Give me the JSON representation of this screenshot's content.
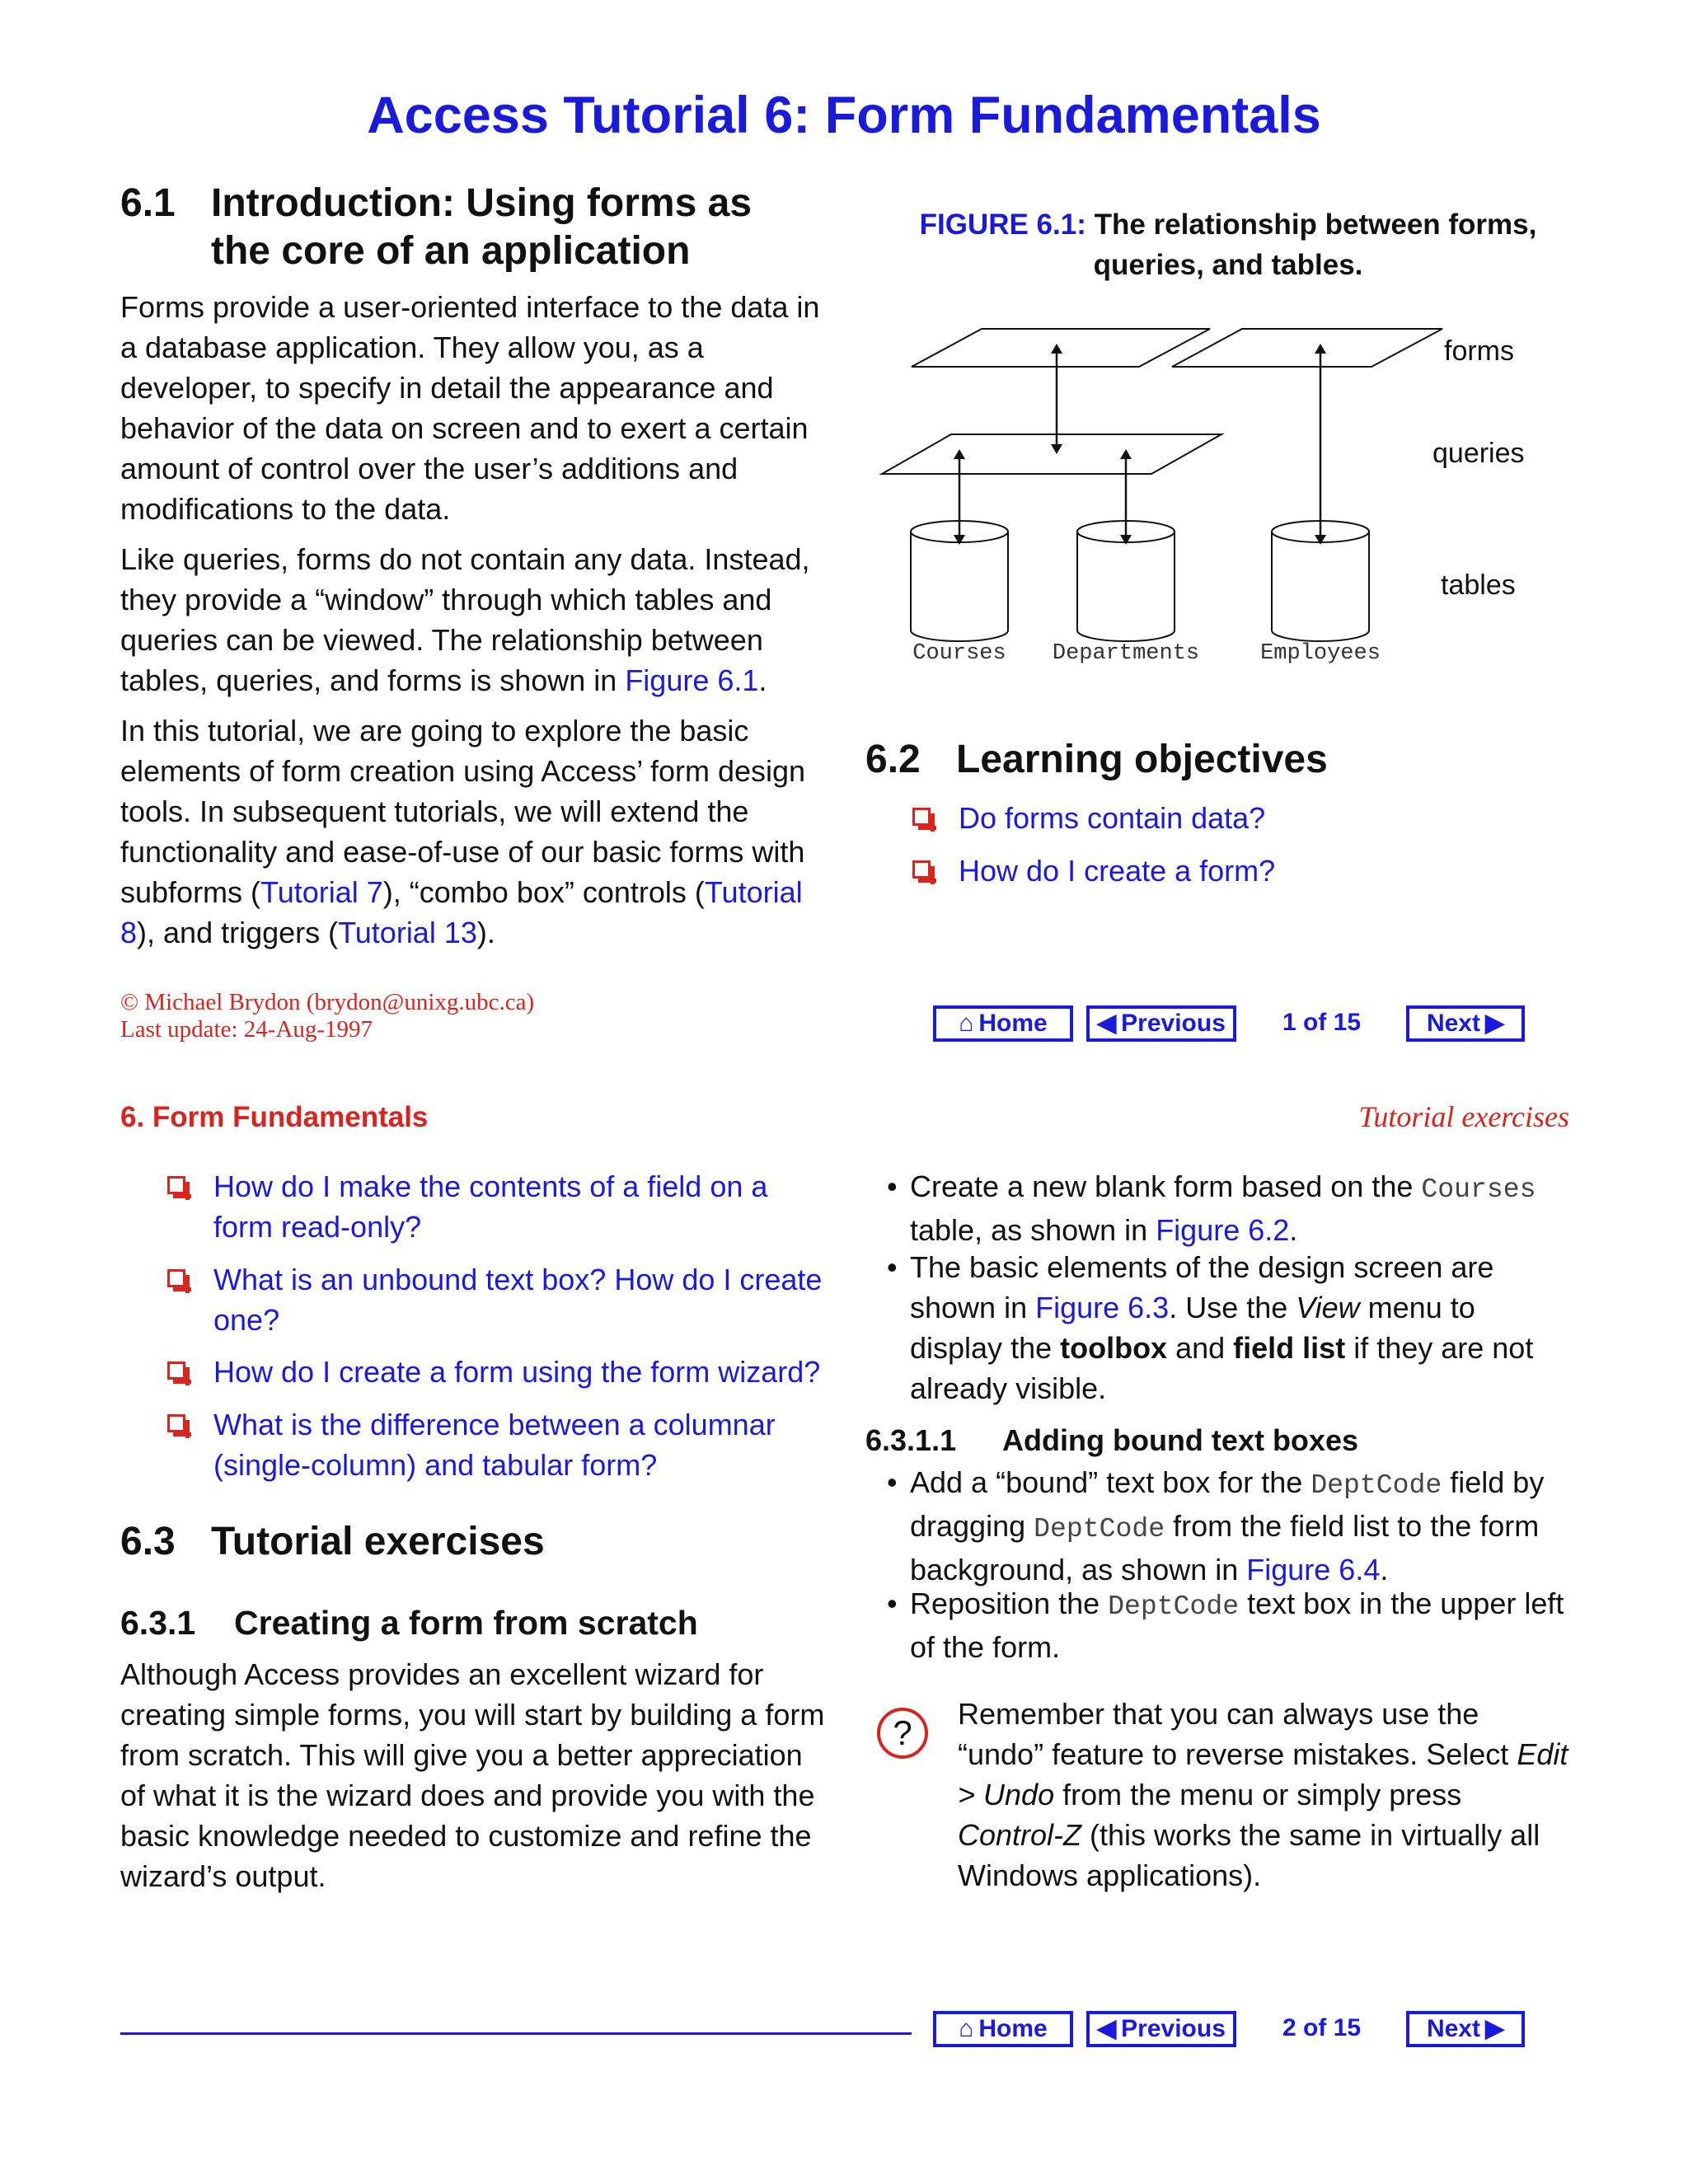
{
  "title": "Access Tutorial 6:  Form Fundamentals",
  "page1": {
    "s61": {
      "num": "6.1",
      "heading_line1": "Introduction: Using forms as",
      "heading_line2": "the core of an application",
      "p1": "Forms provide a user-oriented interface to the data in a database application. They allow you, as a developer, to specify in detail the appearance and behavior of the data on screen and to exert a certain amount of control over the user’s additions and modifications to the data.",
      "p2_a": "Like queries, forms do not contain any data. Instead, they provide a “window” through which tables and queries can be viewed. The relationship between tables, queries, and forms is shown in ",
      "p2_link": "Figure 6.1",
      "p2_b": ".",
      "p3_a": "In this tutorial, we are going to explore the basic elements of form creation using Access’ form design tools. In subsequent tutorials, we will extend the functionality and ease-of-use of our basic forms with subforms (",
      "p3_link1": "Tutorial 7",
      "p3_b": "), “combo box” controls (",
      "p3_link2": "Tutorial 8",
      "p3_c": "), and triggers (",
      "p3_link3": "Tutorial 13",
      "p3_d": ")."
    },
    "figure": {
      "caption_label": "FIGURE 6.1:",
      "caption_line1": "The relationship between forms,",
      "caption_line2": "queries, and tables.",
      "label_forms": "forms",
      "label_queries": "queries",
      "label_tables": "tables",
      "table1": "Courses",
      "table2": "Departments",
      "table3": "Employees"
    },
    "s62": {
      "num": "6.2",
      "heading": "Learning objectives",
      "items": [
        "Do forms contain data?",
        "How do I create a form?"
      ]
    },
    "footer": {
      "copyright": "© Michael Brydon (brydon@unixg.ubc.ca)",
      "update": "Last update: 24-Aug-1997",
      "home": "Home",
      "previous": "Previous",
      "page": "1 of 15",
      "next": "Next"
    }
  },
  "page2": {
    "header_left": "6. Form Fundamentals",
    "header_right": "Tutorial exercises",
    "objectives": [
      "How do I make the contents of a field on a form read-only?",
      "What is an unbound text box? How do I create one?",
      "How do I create a form using the form wizard?",
      "What is the difference between a columnar (single-column) and tabular form?"
    ],
    "s63": {
      "num": "6.3",
      "heading": "Tutorial exercises"
    },
    "s631": {
      "num": "6.3.1",
      "heading": "Creating a form from scratch",
      "p": "Although Access provides an excellent wizard for creating simple forms, you will start by building a form from scratch. This will give you a better appreciation of what it is the wizard does and provide you with the basic knowledge needed to customize and refine the wizard’s output."
    },
    "bullets1": {
      "b1_a": "Create a new blank form based on the ",
      "b1_code": "Courses",
      "b1_b": " table, as shown in ",
      "b1_link": "Figure 6.2",
      "b1_c": ".",
      "b2_a": "The basic elements of the design screen are shown in ",
      "b2_link": "Figure 6.3",
      "b2_b": ". Use the ",
      "b2_view": "View",
      "b2_c": " menu to display the ",
      "b2_toolbox": "toolbox",
      "b2_d": " and ",
      "b2_fieldlist": "field list",
      "b2_e": " if they are not already visible."
    },
    "s6311": {
      "num": "6.3.1.1",
      "heading": "Adding bound text boxes",
      "b3_a": "Add a “bound” text box for the ",
      "b3_code1": "DeptCode",
      "b3_b": " field by dragging ",
      "b3_code2": "DeptCode",
      "b3_c": " from the field list to the form background, as shown in ",
      "b3_link": "Figure 6.4",
      "b3_d": ".",
      "b4_a": "Reposition the ",
      "b4_code": "DeptCode",
      "b4_b": " text box in the upper left of the form."
    },
    "tip": {
      "t1": "Remember that you can always use the “undo” feature to reverse mistakes. Select ",
      "t_edit": "Edit > Undo",
      "t2": " from the menu or simply press ",
      "t_ctrl": "Control-Z",
      "t3": " (this works the same in virtually all Windows applications)."
    },
    "footer": {
      "home": "Home",
      "previous": "Previous",
      "page": "2 of 15",
      "next": "Next"
    }
  }
}
